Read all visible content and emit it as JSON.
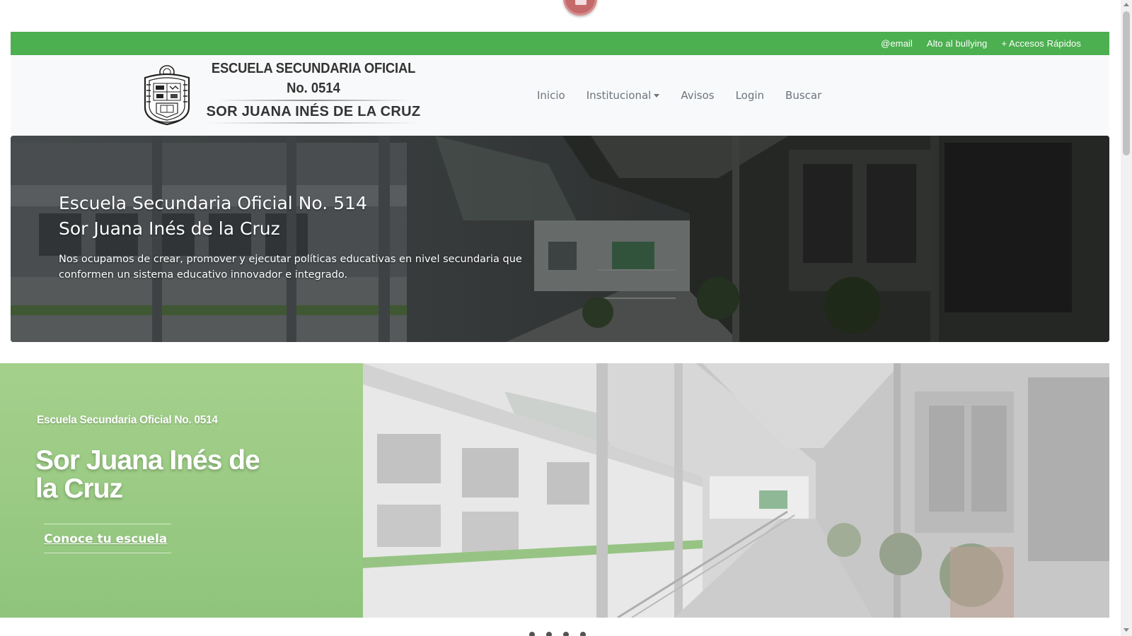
{
  "top_icon": "video-camera-icon",
  "topbar": {
    "links": [
      "@email",
      "Alto al bullying",
      "+ Accesos Rápidos"
    ],
    "color": "#4caf50"
  },
  "header": {
    "logo": {
      "line1": "ESCUELA SECUNDARIA OFICIAL",
      "line2": "No. 0514",
      "line3": "SOR JUANA INÉS DE LA CRUZ"
    },
    "nav": {
      "inicio": "Inicio",
      "institucional": "Institucional",
      "avisos": "Avisos",
      "login": "Login",
      "buscar": "Buscar"
    }
  },
  "hero": {
    "title_line1": "Escuela Secundaria Oficial No. 514",
    "title_line2": "Sor Juana Inés de la Cruz",
    "description": "Nos ocupamos de crear, promover y ejecutar políticas educativas en nivel secundaria que conformen un sistema educativo innovador e integrado."
  },
  "feature": {
    "subtitle": "Escuela Secundaria Oficial No. 0514",
    "title": "Sor Juana Inés de la Cruz",
    "button": "Conoce tu escuela",
    "accent_color": "#9dcc86"
  }
}
